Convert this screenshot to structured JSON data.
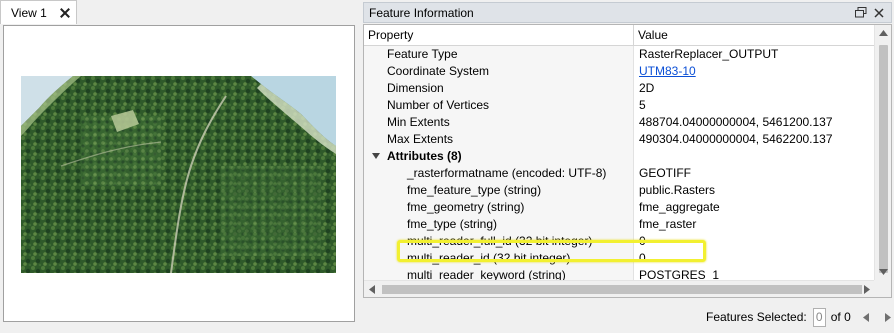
{
  "view_tab": {
    "label": "View 1"
  },
  "panel": {
    "title": "Feature Information"
  },
  "table": {
    "headers": {
      "property": "Property",
      "value": "Value"
    },
    "rows": [
      {
        "property": "Feature Type",
        "value": "RasterReplacer_OUTPUT"
      },
      {
        "property": "Coordinate System",
        "value": "UTM83-10"
      },
      {
        "property": "Dimension",
        "value": "2D"
      },
      {
        "property": "Number of Vertices",
        "value": "5"
      },
      {
        "property": "Min Extents",
        "value": "488704.04000000004, 5461200.137"
      },
      {
        "property": "Max Extents",
        "value": "490304.04000000004, 5462200.137"
      },
      {
        "property": "Attributes (8)",
        "value": ""
      },
      {
        "property": "_rasterformatname (encoded: UTF-8)",
        "value": "GEOTIFF"
      },
      {
        "property": "fme_feature_type (string)",
        "value": "public.Rasters"
      },
      {
        "property": "fme_geometry (string)",
        "value": "fme_aggregate"
      },
      {
        "property": "fme_type (string)",
        "value": "fme_raster"
      },
      {
        "property": "multi_reader_full_id (32 bit integer)",
        "value": "0"
      },
      {
        "property": "multi_reader_id (32 bit integer)",
        "value": "0"
      },
      {
        "property": "multi_reader_keyword (string)",
        "value": "POSTGRES_1"
      }
    ]
  },
  "status": {
    "features_selected_label": "Features Selected:",
    "selected_count": "0",
    "of_label": "of 0"
  },
  "colors": {
    "highlight": "#f2f030",
    "link": "#0b4fd6",
    "header_bg": "#dfe3e8"
  }
}
